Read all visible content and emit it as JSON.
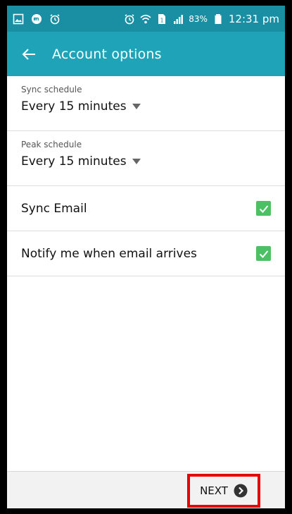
{
  "status_bar": {
    "battery": "83%",
    "time": "12:31 pm"
  },
  "app_bar": {
    "title": "Account options"
  },
  "settings": {
    "sync_schedule": {
      "label": "Sync schedule",
      "value": "Every 15 minutes"
    },
    "peak_schedule": {
      "label": "Peak schedule",
      "value": "Every 15 minutes"
    },
    "sync_email": {
      "label": "Sync Email",
      "checked": true
    },
    "notify": {
      "label": "Notify me when email arrives",
      "checked": true
    }
  },
  "bottom_bar": {
    "next_label": "NEXT"
  },
  "colors": {
    "status_bar": "#1a8fa4",
    "app_bar": "#1ea3b9",
    "checkbox": "#4cc064",
    "highlight": "#e60000"
  }
}
